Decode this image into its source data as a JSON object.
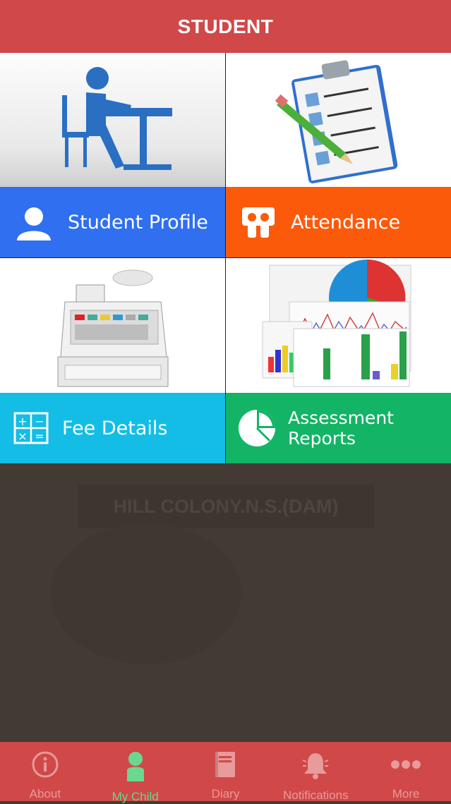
{
  "header": {
    "title": "STUDENT"
  },
  "tiles": [
    {
      "label": "Student Profile",
      "color": "#2f6ff0"
    },
    {
      "label": "Attendance",
      "color": "#fb5a0b"
    },
    {
      "label": "Fee Details",
      "color": "#13bde6"
    },
    {
      "label_line1": "Assessment",
      "label_line2": "Reports",
      "color": "#13b465"
    }
  ],
  "background": {
    "school_name": "HILL COLONY.N.S.(DAM)"
  },
  "tabbar": {
    "active_color": "#6ad88e",
    "items": [
      {
        "label": "About",
        "icon": "info-icon"
      },
      {
        "label": "My Child",
        "icon": "child-icon",
        "active": true
      },
      {
        "label": "Diary",
        "icon": "diary-icon"
      },
      {
        "label": "Notifications",
        "icon": "bell-icon"
      },
      {
        "label": "More",
        "icon": "more-icon"
      }
    ]
  }
}
